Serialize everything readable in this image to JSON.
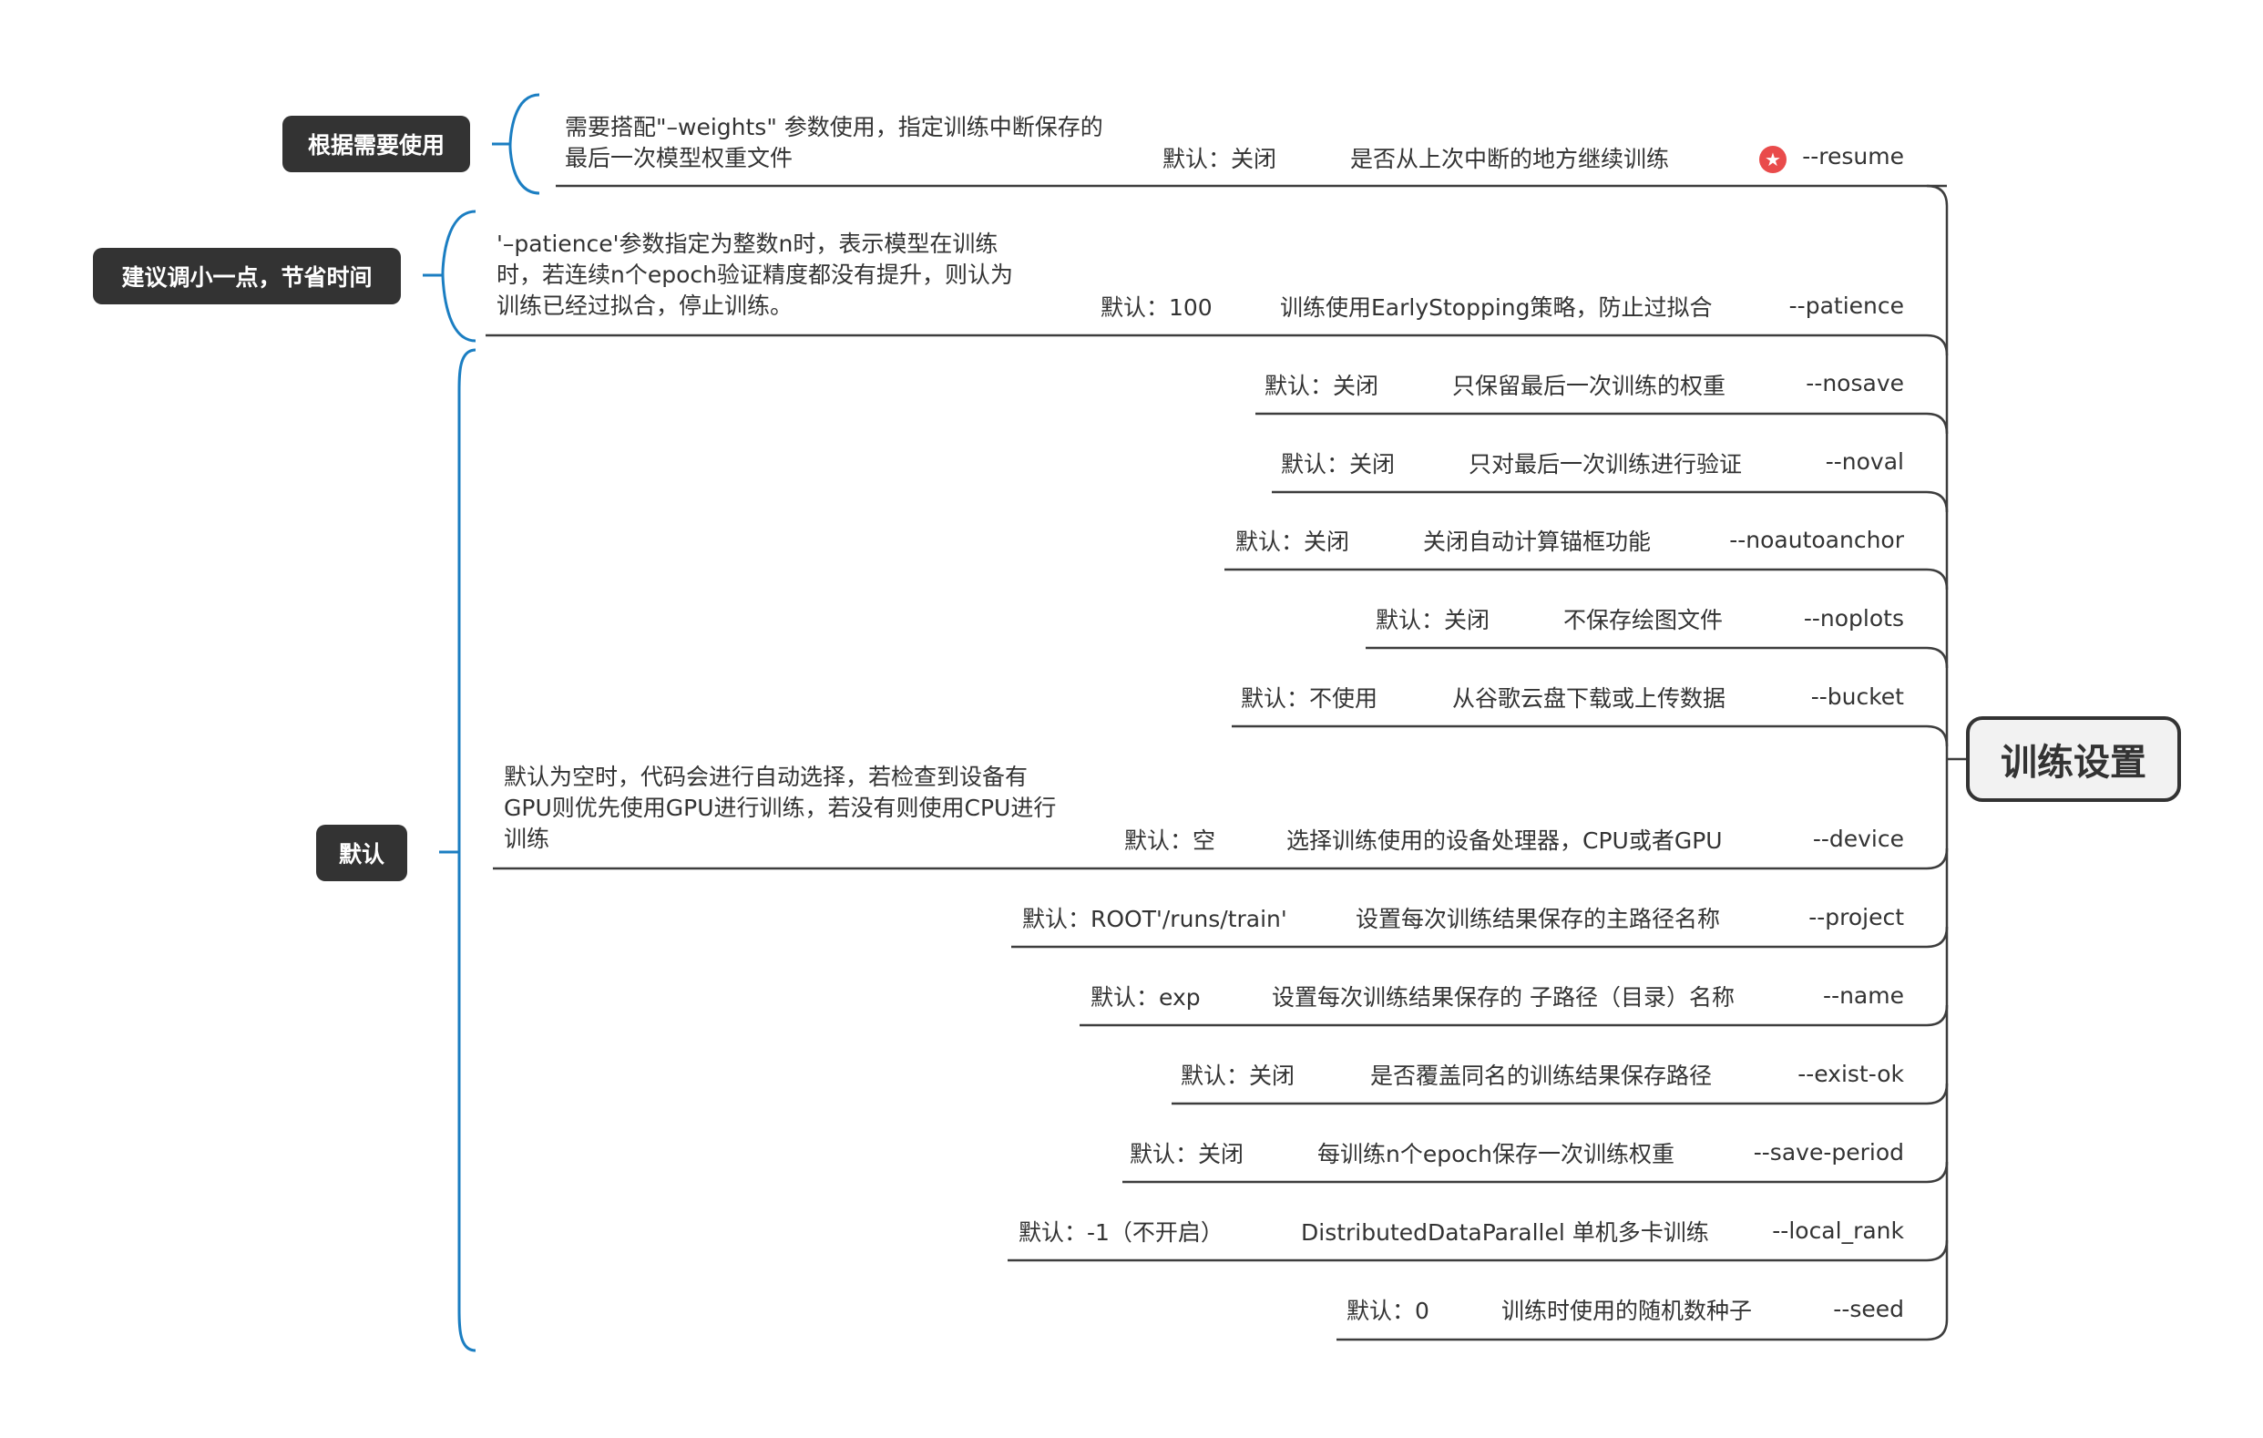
{
  "central_topic": "训练设置",
  "colors": {
    "line": "#3d3d3d",
    "bracket": "#1b7ec2",
    "tag_bg": "#333333",
    "star": "#e94b4b"
  },
  "branches": [
    {
      "param": "--resume",
      "desc": "是否从上次中断的地方继续训练",
      "default": "默认：关闭",
      "note": "需要搭配\"–weights\" 参数使用，指定训练中断保存的最后一次模型权重文件",
      "icon": "star-icon"
    },
    {
      "param": "--patience",
      "desc": "训练使用EarlyStopping策略，防止过拟合",
      "default": "默认：100",
      "note": "'–patience'参数指定为整数n时，表示模型在训练时，若连续n个epoch验证精度都没有提升，则认为训练已经过拟合，停止训练。"
    },
    {
      "param": "--nosave",
      "desc": "只保留最后一次训练的权重",
      "default": "默认：关闭"
    },
    {
      "param": "--noval",
      "desc": "只对最后一次训练进行验证",
      "default": "默认：关闭"
    },
    {
      "param": "--noautoanchor",
      "desc": "关闭自动计算锚框功能",
      "default": "默认：关闭"
    },
    {
      "param": "--noplots",
      "desc": "不保存绘图文件",
      "default": "默认：关闭"
    },
    {
      "param": "--bucket",
      "desc": "从谷歌云盘下载或上传数据",
      "default": "默认：不使用"
    },
    {
      "param": "--device",
      "desc": "选择训练使用的设备处理器，CPU或者GPU",
      "default": "默认：空",
      "note": "默认为空时，代码会进行自动选择，若检查到设备有GPU则优先使用GPU进行训练，若没有则使用CPU进行训练"
    },
    {
      "param": "--project",
      "desc": "设置每次训练结果保存的主路径名称",
      "default": "默认：ROOT'/runs/train'"
    },
    {
      "param": "--name",
      "desc": "设置每次训练结果保存的 子路径（目录）名称",
      "default": "默认：exp"
    },
    {
      "param": "--exist-ok",
      "desc": "是否覆盖同名的训练结果保存路径",
      "default": "默认：关闭"
    },
    {
      "param": "--save-period",
      "desc": "每训练n个epoch保存一次训练权重",
      "default": "默认：关闭"
    },
    {
      "param": "--local_rank",
      "desc": "DistributedDataParallel 单机多卡训练",
      "default": "默认：-1（不开启）"
    },
    {
      "param": "--seed",
      "desc": "训练时使用的随机数种子",
      "default": "默认：0"
    }
  ],
  "groups": [
    {
      "label": "根据需要使用"
    },
    {
      "label": "建议调小一点，节省时间"
    },
    {
      "label": "默认"
    }
  ]
}
